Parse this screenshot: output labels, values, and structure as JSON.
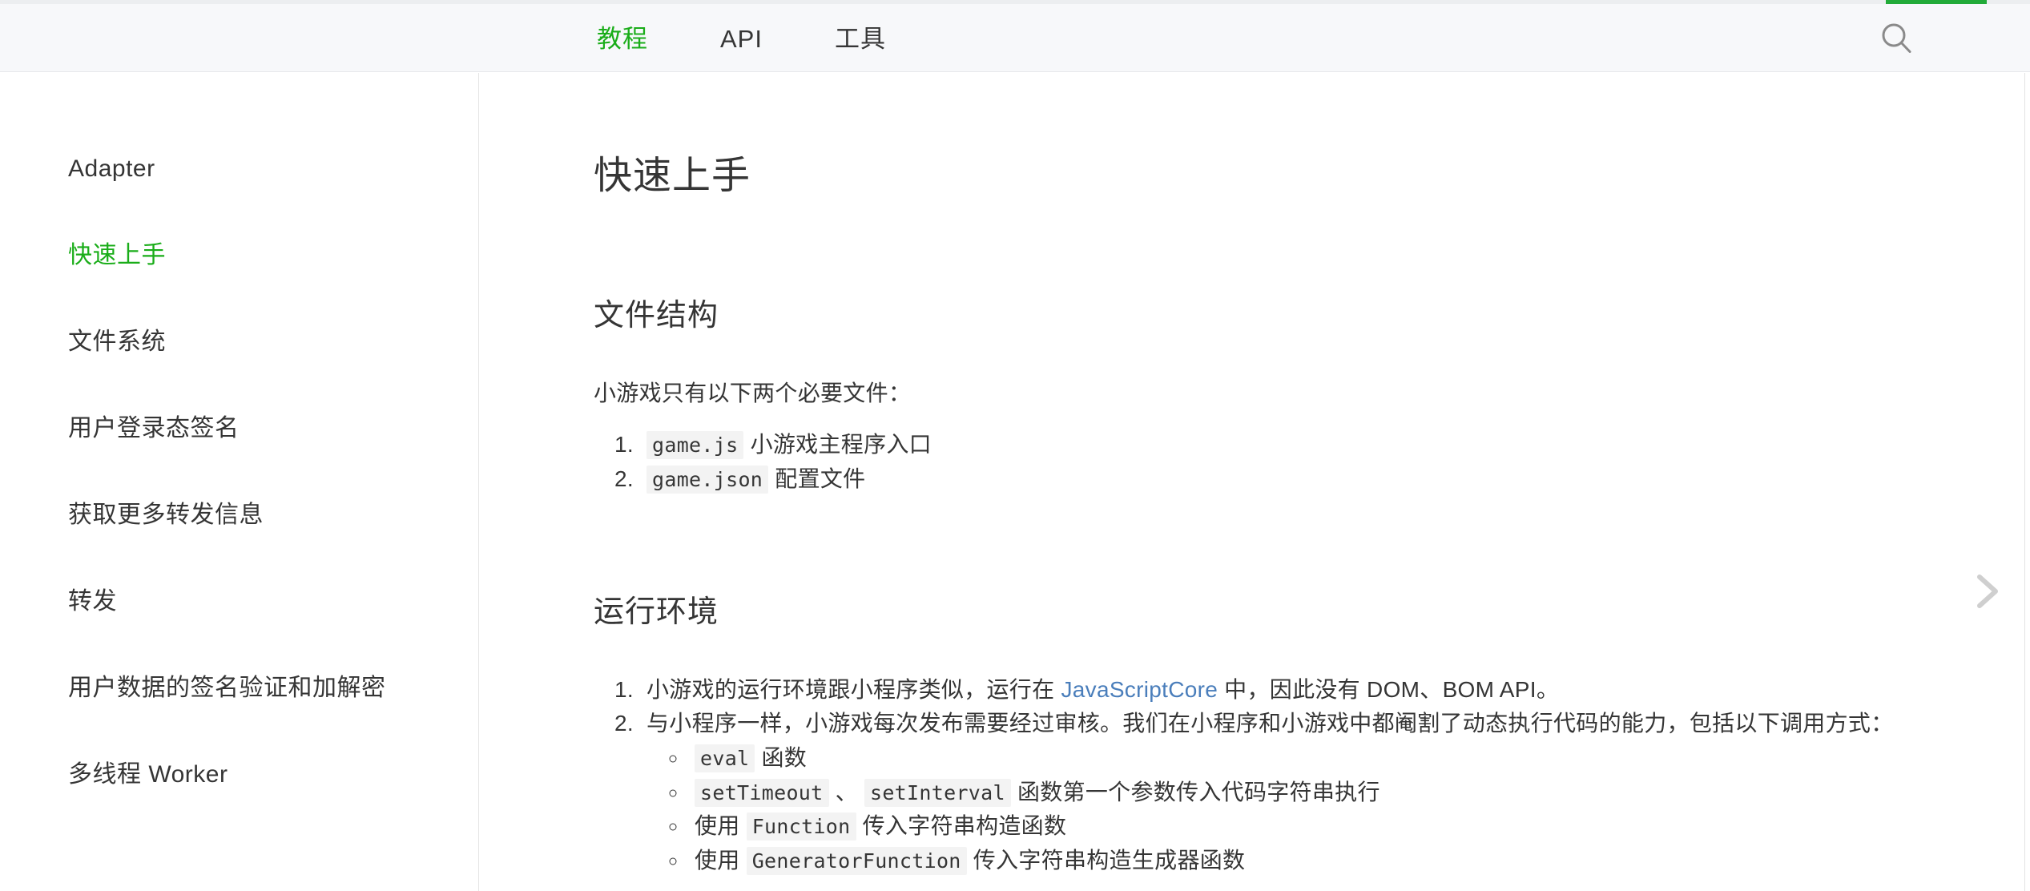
{
  "progress": {
    "percent": 95,
    "color": "#22ab39"
  },
  "header": {
    "tabs": [
      {
        "label": "教程",
        "active": true
      },
      {
        "label": "API",
        "active": false
      },
      {
        "label": "工具",
        "active": false
      }
    ],
    "search_icon": "search-icon"
  },
  "sidebar": {
    "items": [
      {
        "label": "Adapter",
        "active": false
      },
      {
        "label": "快速上手",
        "active": true
      },
      {
        "label": "文件系统",
        "active": false
      },
      {
        "label": "用户登录态签名",
        "active": false
      },
      {
        "label": "获取更多转发信息",
        "active": false
      },
      {
        "label": "转发",
        "active": false
      },
      {
        "label": "用户数据的签名验证和加解密",
        "active": false
      },
      {
        "label": "多线程 Worker",
        "active": false
      }
    ]
  },
  "doc": {
    "title": "快速上手",
    "section1": {
      "heading": "文件结构",
      "intro": "小游戏只有以下两个必要文件：",
      "items": [
        {
          "code": "game.js",
          "text": "小游戏主程序入口"
        },
        {
          "code": "game.json",
          "text": "配置文件"
        }
      ]
    },
    "section2": {
      "heading": "运行环境",
      "item1": {
        "prefix": "小游戏的运行环境跟小程序类似，运行在 ",
        "link": "JavaScriptCore",
        "suffix": " 中，因此没有 DOM、BOM API。"
      },
      "item2": {
        "text": "与小程序一样，小游戏每次发布需要经过审核。我们在小程序和小游戏中都阉割了动态执行代码的能力，包括以下调用方式："
      },
      "subitems": [
        {
          "pre": "",
          "code1": "eval",
          "mid": "",
          "code2": "",
          "post": " 函数"
        },
        {
          "pre": "",
          "code1": "setTimeout",
          "mid": " 、 ",
          "code2": "setInterval",
          "post": " 函数第一个参数传入代码字符串执行"
        },
        {
          "pre": "使用 ",
          "code1": "Function",
          "mid": "",
          "code2": "",
          "post": " 传入字符串构造函数"
        },
        {
          "pre": "使用 ",
          "code1": "GeneratorFunction",
          "mid": "",
          "code2": "",
          "post": " 传入字符串构造生成器函数"
        }
      ]
    }
  },
  "next_page": {
    "icon": "chevron-right-icon"
  },
  "colors": {
    "accent_green": "#1aad19",
    "link_blue": "#4a7ebb",
    "header_bg": "#f7f8fa",
    "code_bg": "#f3f3f3",
    "text": "#353535"
  }
}
